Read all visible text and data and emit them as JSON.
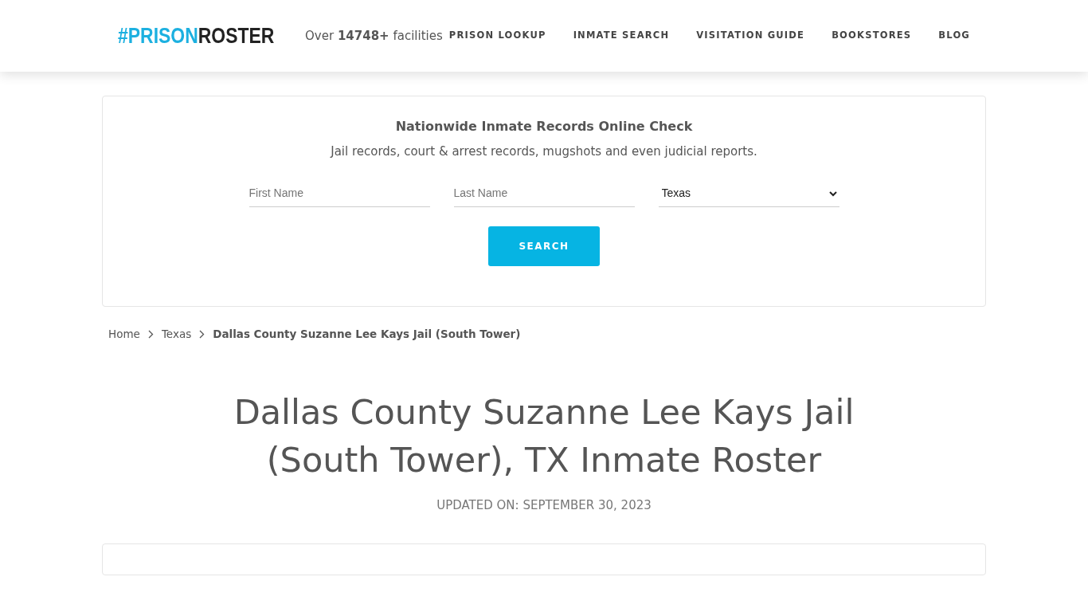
{
  "header": {
    "logo": [
      {
        "text": "#PRISON",
        "kind": "accent"
      },
      {
        "text": "ROSTER",
        "kind": "dark"
      }
    ],
    "tagline": "Over **14748+** facilities",
    "nav": [
      "PRISON LOOKUP",
      "INMATE SEARCH",
      "VISITATION GUIDE",
      "BOOKSTORES",
      "BLOG"
    ]
  },
  "search_card": {
    "title": "Nationwide Inmate Records Online Check",
    "subtitle": "Jail records, court & arrest records, mugshots and even judicial reports.",
    "first_name": {
      "placeholder": "First Name"
    },
    "last_name": {
      "placeholder": "Last Name"
    },
    "state": {
      "value": "Texas"
    },
    "button": "SEARCH"
  },
  "breadcrumb": [
    {
      "label": "Home",
      "current": false
    },
    {
      "label": "Texas",
      "current": false
    },
    {
      "label": "Dallas County Suzanne Lee Kays Jail (South Tower)",
      "current": true
    }
  ],
  "page_title": "Dallas County Suzanne Lee Kays Jail (South Tower), TX Inmate Roster",
  "updated": "UPDATED ON: SEPTEMBER 30, 2023"
}
